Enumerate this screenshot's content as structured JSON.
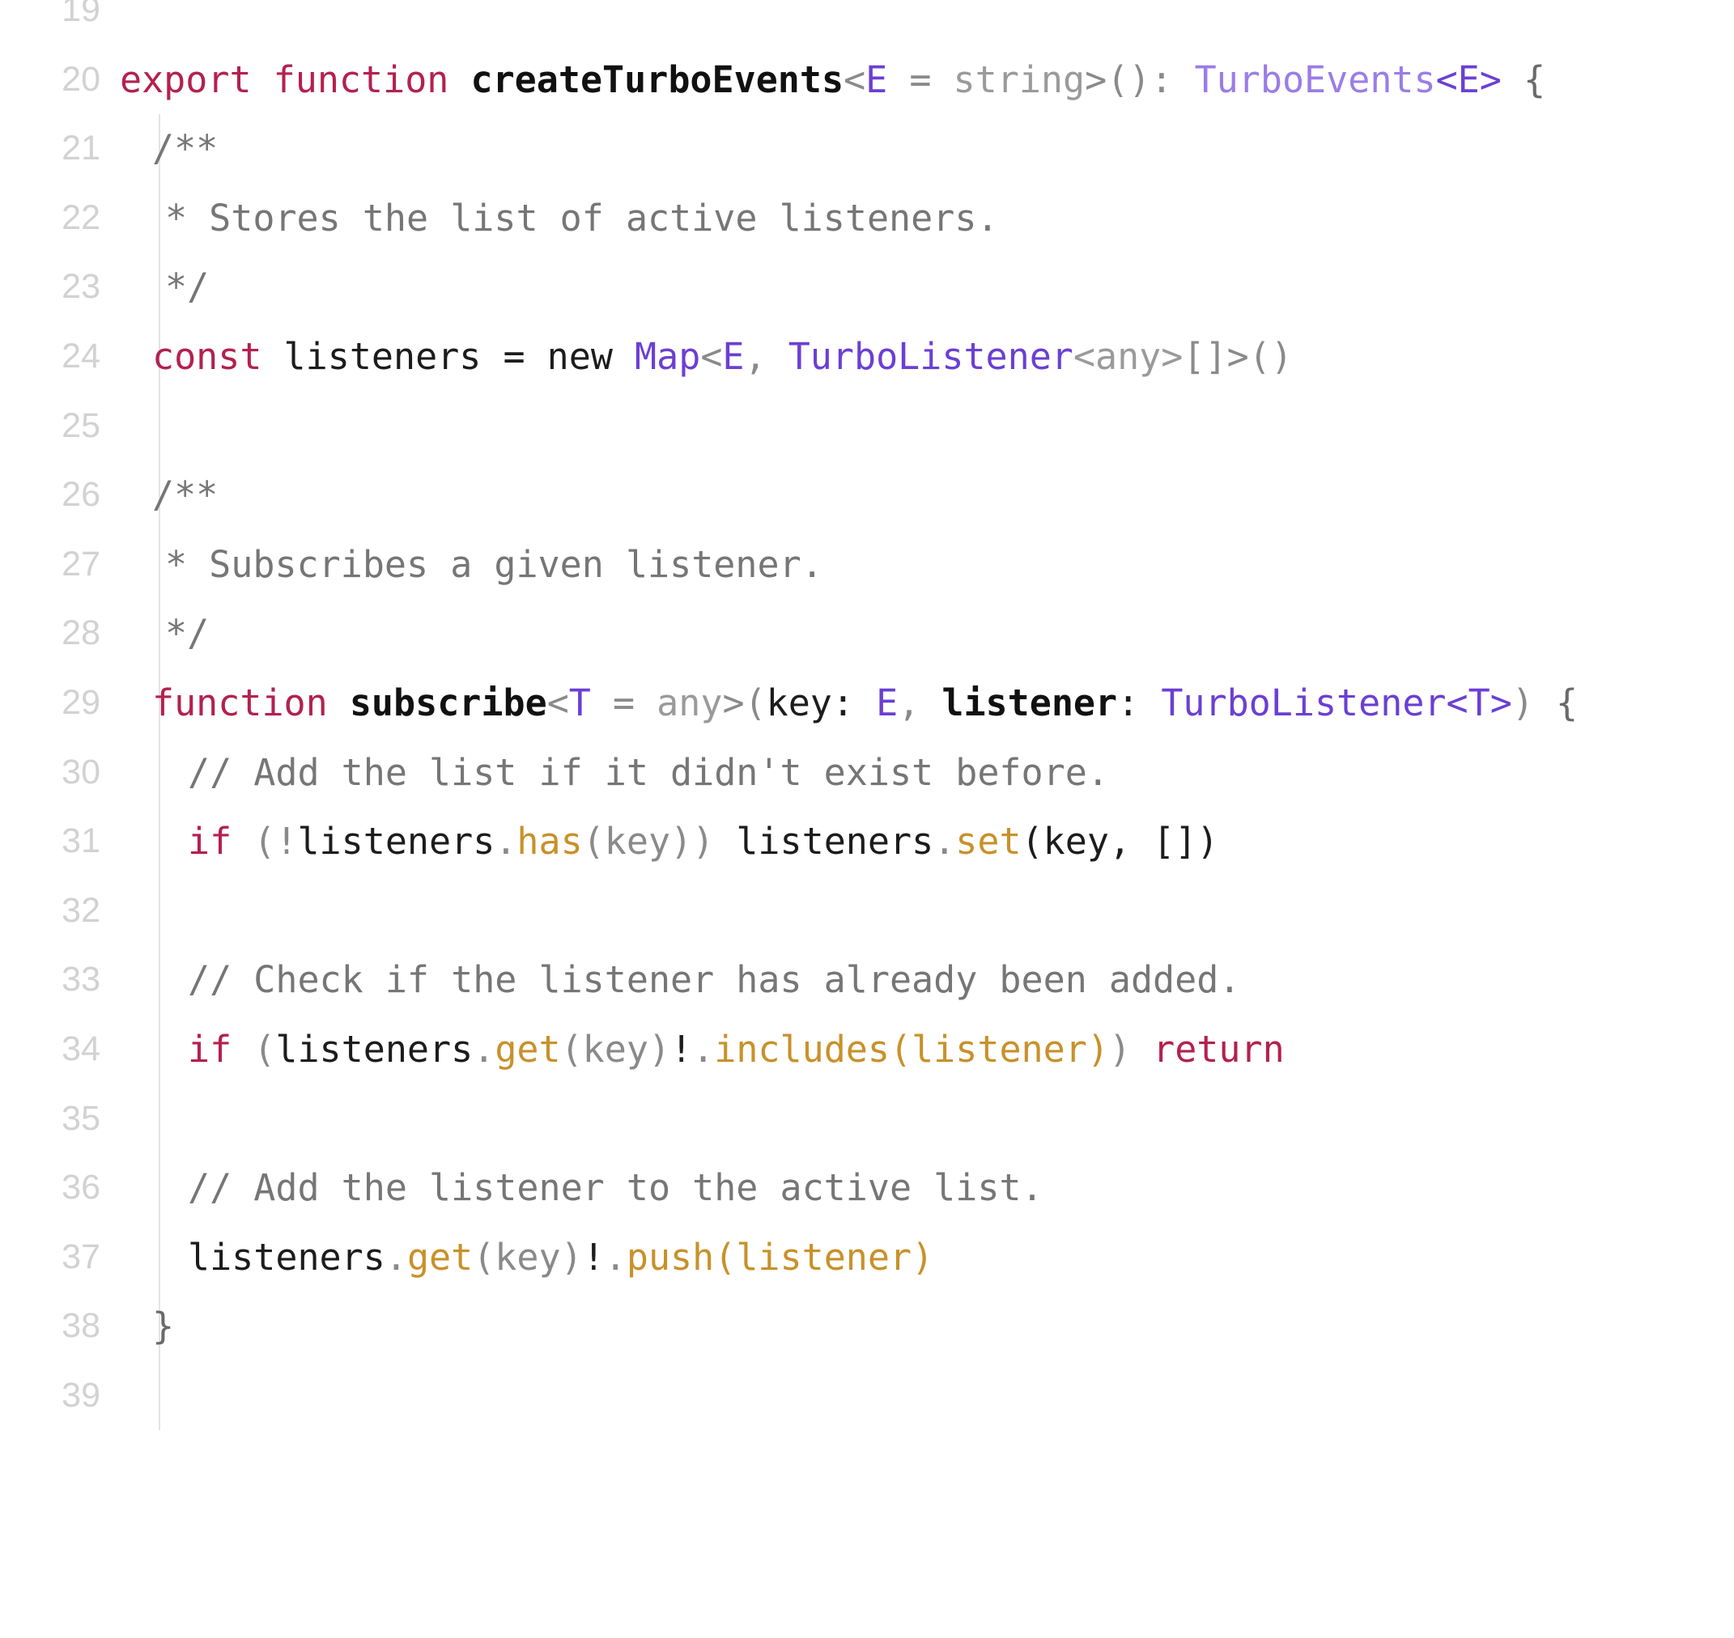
{
  "editor": {
    "language": "typescript",
    "background": "#ffffff",
    "gutter_color": "#d2d2d2",
    "indent_guide_color": "#e4e4e4",
    "font_size_px": 45,
    "line_height_px": 85.6,
    "first_visible_line": 19,
    "last_visible_line": 39
  },
  "theme": {
    "keyword": "#b3214f",
    "function_name": "#111111",
    "plain": "#1c1c1c",
    "punctuation": "#8a8a8a",
    "type": "#6b3fd4",
    "type_light": "#9b7ce8",
    "type_default": "#9a9a9a",
    "comment": "#767676",
    "method": "#c8912a",
    "brace": "#6a6a6a"
  },
  "code": {
    "lines": [
      {
        "number": "19",
        "text": "",
        "clipped": true
      },
      {
        "number": "20",
        "text": "export function createTurboEvents<E = string>(): TurboEvents<E> {"
      },
      {
        "number": "21",
        "text": "  /**"
      },
      {
        "number": "22",
        "text": "   * Stores the list of active listeners."
      },
      {
        "number": "23",
        "text": "   */"
      },
      {
        "number": "24",
        "text": "  const listeners = new Map<E, TurboListener<any>[]>()"
      },
      {
        "number": "25",
        "text": ""
      },
      {
        "number": "26",
        "text": "  /**"
      },
      {
        "number": "27",
        "text": "   * Subscribes a given listener."
      },
      {
        "number": "28",
        "text": "   */"
      },
      {
        "number": "29",
        "text": "  function subscribe<T = any>(key: E, listener: TurboListener<T>) {"
      },
      {
        "number": "30",
        "text": "    // Add the list if it didn't exist before."
      },
      {
        "number": "31",
        "text": "    if (!listeners.has(key)) listeners.set(key, [])"
      },
      {
        "number": "32",
        "text": ""
      },
      {
        "number": "33",
        "text": "    // Check if the listener has already been added."
      },
      {
        "number": "34",
        "text": "    if (listeners.get(key)!.includes(listener)) return"
      },
      {
        "number": "35",
        "text": ""
      },
      {
        "number": "36",
        "text": "    // Add the listener to the active list."
      },
      {
        "number": "37",
        "text": "    listeners.get(key)!.push(listener)"
      },
      {
        "number": "38",
        "text": "  }"
      },
      {
        "number": "39",
        "text": "",
        "clipped": true
      }
    ]
  },
  "tokens": {
    "line20": {
      "export": "export",
      "function": "function",
      "name": "createTurboEvents",
      "generic_open": "<",
      "generic_param": "E",
      "equals": " = ",
      "generic_default": "string",
      "generic_close": ">",
      "call_parens": "(): ",
      "return_type": "TurboEvents",
      "return_generic": "<E>",
      "brace": " {"
    },
    "line21": {
      "comment": "/**"
    },
    "line22": {
      "comment": "* Stores the list of active listeners."
    },
    "line23": {
      "comment": "*/"
    },
    "line24": {
      "const": "const",
      "varname": " listeners ",
      "assign": "= ",
      "new": "new ",
      "map": "Map",
      "lt": "<",
      "e": "E",
      "comma": ", ",
      "turbolistener": "TurboListener",
      "any_generic": "<any>",
      "array": "[]",
      "gt": ">",
      "parens": "()"
    },
    "line26": {
      "comment": "/**"
    },
    "line27": {
      "comment": "* Subscribes a given listener."
    },
    "line28": {
      "comment": "*/"
    },
    "line29": {
      "function": "function",
      "name": "subscribe",
      "lt": "<",
      "t": "T",
      "equals": " = ",
      "any": "any",
      "gt": ">",
      "open_paren": "(",
      "key": "key",
      "colon": ": ",
      "e": "E",
      "comma": ", ",
      "listener": "listener",
      "colon2": ": ",
      "type": "TurboListener",
      "type_generic": "<T>",
      "close_paren": ")",
      "brace": " {"
    },
    "line30": {
      "comment": "// Add the list if it didn't exist before."
    },
    "line31": {
      "if": "if",
      "open": " (!",
      "listeners": "listeners",
      "dot": ".",
      "has": "has",
      "key_call": "(key))",
      "listeners2": " listeners",
      "dot2": ".",
      "set": "set",
      "args": "(key, [])"
    },
    "line33": {
      "comment": "// Check if the listener has already been added."
    },
    "line34": {
      "if": "if",
      "open": " (",
      "listeners": "listeners",
      "dot": ".",
      "get": "get",
      "key_call": "(key)",
      "bang": "!",
      "dot2": ".",
      "includes": "includes",
      "arg_open": "(",
      "arg": "listener",
      "arg_close": ")",
      "close": ")",
      "return": " return"
    },
    "line36": {
      "comment": "// Add the listener to the active list."
    },
    "line37": {
      "listeners": "listeners",
      "dot": ".",
      "get": "get",
      "key_call": "(key)",
      "bang": "!",
      "dot2": ".",
      "push": "push",
      "arg_open": "(",
      "arg": "listener",
      "arg_close": ")"
    },
    "line38": {
      "brace": "}"
    }
  }
}
